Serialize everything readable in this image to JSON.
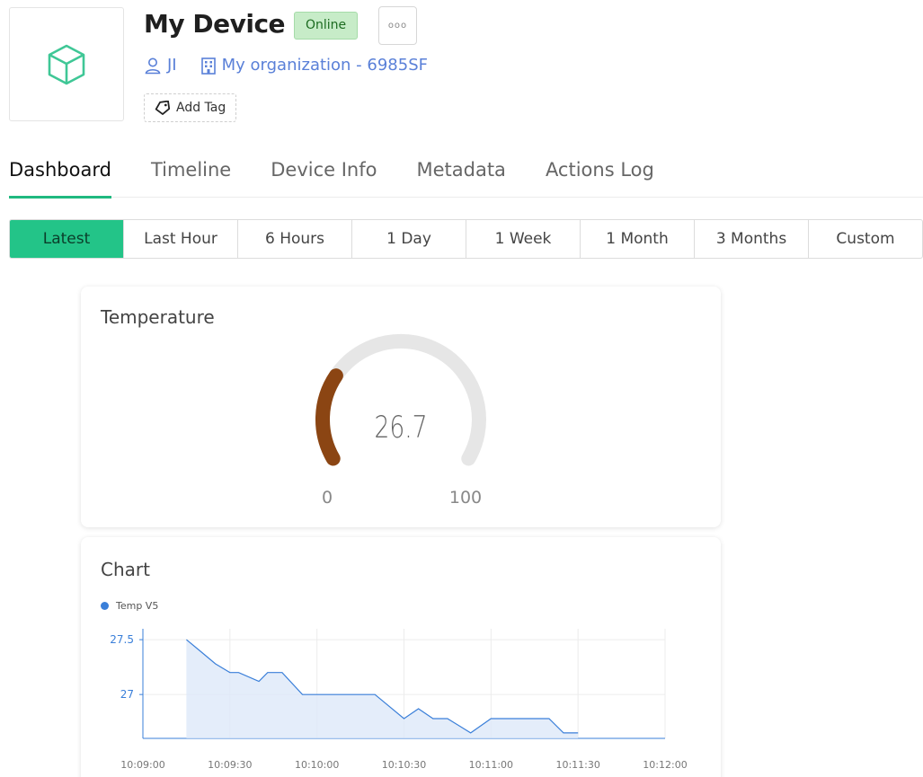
{
  "device": {
    "title": "My Device",
    "status": "Online",
    "owner": "JI",
    "organization": "My organization - 6985SF",
    "add_tag_label": "Add Tag",
    "more_label": "ooo"
  },
  "tabs": [
    {
      "label": "Dashboard",
      "active": true
    },
    {
      "label": "Timeline",
      "active": false
    },
    {
      "label": "Device Info",
      "active": false
    },
    {
      "label": "Metadata",
      "active": false
    },
    {
      "label": "Actions Log",
      "active": false
    }
  ],
  "time_ranges": [
    {
      "label": "Latest",
      "active": true
    },
    {
      "label": "Last Hour",
      "active": false
    },
    {
      "label": "6 Hours",
      "active": false
    },
    {
      "label": "1 Day",
      "active": false
    },
    {
      "label": "1 Week",
      "active": false
    },
    {
      "label": "1 Month",
      "active": false
    },
    {
      "label": "3 Months",
      "active": false
    },
    {
      "label": "Custom",
      "active": false
    }
  ],
  "gauge": {
    "title": "Temperature",
    "value_label": "26.7",
    "value": 26.7,
    "min_label": "0",
    "max_label": "100",
    "min": 0,
    "max": 100,
    "fill_color": "#8b4513",
    "track_color": "#e6e6e6"
  },
  "chart": {
    "title": "Chart",
    "legend_label": "Temp V5"
  },
  "chart_data": {
    "type": "area",
    "series": [
      {
        "name": "Temp V5",
        "color": "#3a7fd9",
        "x": [
          "10:09:15",
          "10:09:20",
          "10:09:25",
          "10:09:30",
          "10:09:33",
          "10:09:40",
          "10:09:43",
          "10:09:48",
          "10:09:55",
          "10:10:00",
          "10:10:10",
          "10:10:20",
          "10:10:30",
          "10:10:35",
          "10:10:40",
          "10:10:45",
          "10:10:53",
          "10:11:00",
          "10:11:10",
          "10:11:20",
          "10:11:25",
          "10:11:30"
        ],
        "values": [
          27.5,
          27.39,
          27.28,
          27.2,
          27.2,
          27.12,
          27.2,
          27.2,
          27.0,
          27.0,
          27.0,
          27.0,
          26.78,
          26.87,
          26.78,
          26.78,
          26.65,
          26.78,
          26.78,
          26.78,
          26.65,
          26.65
        ]
      }
    ],
    "xlim": [
      "10:09:00",
      "10:12:00"
    ],
    "xticks": [
      "10:09:00",
      "10:09:30",
      "10:10:00",
      "10:10:30",
      "10:11:00",
      "10:11:30",
      "10:12:00"
    ],
    "yticks": [
      "27.5",
      "27"
    ],
    "ylim": [
      26.6,
      27.55
    ],
    "grid": true,
    "legend_position": "top-left"
  }
}
